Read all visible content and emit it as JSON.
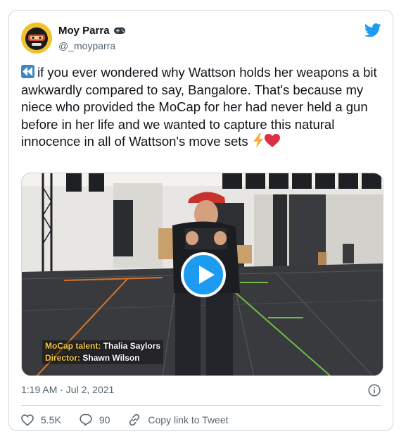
{
  "user": {
    "display_name": "Moy Parra",
    "handle": "@_moyparra",
    "name_emoji": "gamepad-icon"
  },
  "tweet": {
    "text": "if you ever wondered why Wattson holds her weapons a bit awkwardly compared to say, Bangalore. That's because my niece who provided the MoCap for her had never held a gun before in her life and we wanted to capture this natural innocence in all of Wattson's move sets",
    "leading_emoji": "rewind-icon",
    "trailing_emojis": [
      "lightning-icon",
      "heart-icon"
    ]
  },
  "video": {
    "caption_line1_label": "MoCap talent:",
    "caption_line1_value": "Thalia Saylors",
    "caption_line2_label": "Director:",
    "caption_line2_value": "Shawn Wilson"
  },
  "meta": {
    "timestamp": "1:19 AM · Jul 2, 2021"
  },
  "actions": {
    "likes": "5.5K",
    "replies": "90",
    "copy_link": "Copy link to Tweet"
  },
  "colors": {
    "accent": "#1d9bf0",
    "text": "#0f1419",
    "muted": "#536471",
    "border": "#cfd9de"
  }
}
